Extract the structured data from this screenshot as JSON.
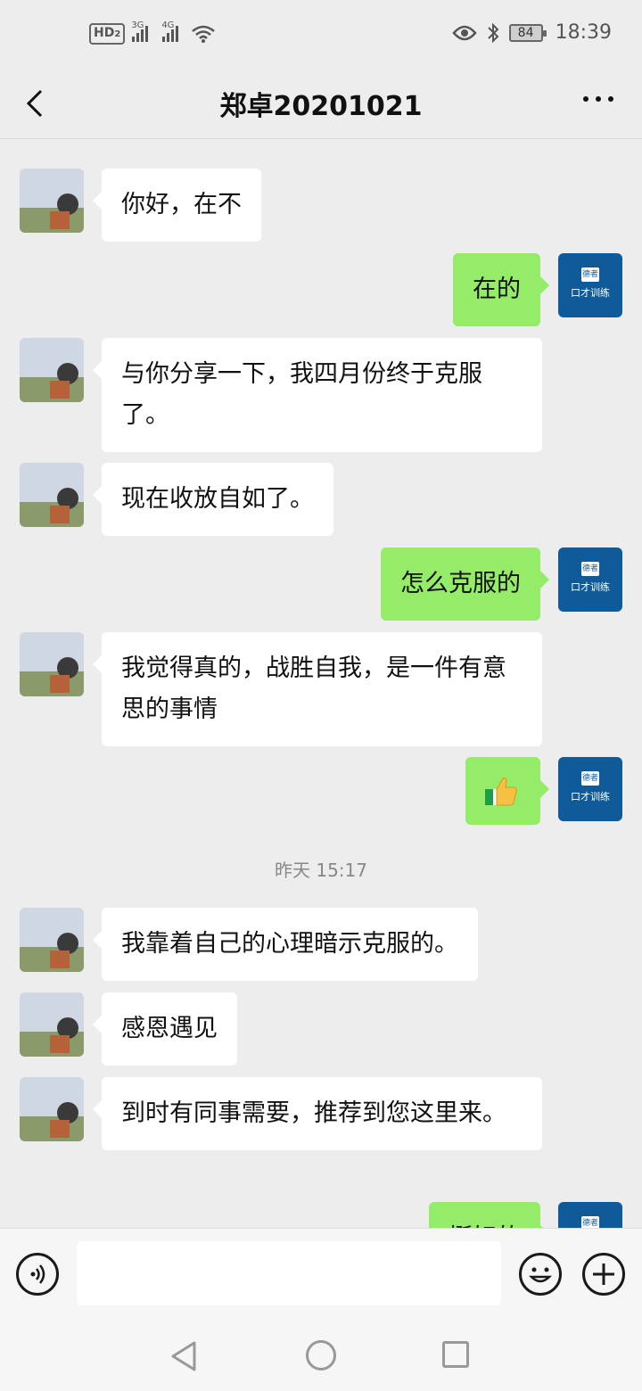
{
  "status_bar": {
    "hd_label": "HD",
    "hd_sub": "2",
    "sim1": "3G",
    "sim2": "4G",
    "battery": "84",
    "time": "18:39"
  },
  "header": {
    "title": "郑卓20201021"
  },
  "avatar_me": {
    "brand_top": "德者",
    "brand_bottom": "口才训练"
  },
  "messages": [
    {
      "side": "other",
      "text": "你好，在不"
    },
    {
      "side": "me",
      "text": "在的"
    },
    {
      "side": "other",
      "text": "与你分享一下，我四月份终于克服了。"
    },
    {
      "side": "other",
      "text": "现在收放自如了。"
    },
    {
      "side": "me",
      "text": "怎么克服的"
    },
    {
      "side": "other",
      "text": "我觉得真的，战胜自我，是一件有意思的事情"
    },
    {
      "side": "me",
      "text": "👍",
      "emoji": "thumbs-up"
    },
    {
      "side": "other",
      "text": "我靠着自己的心理暗示克服的。"
    },
    {
      "side": "other",
      "text": "感恩遇见"
    },
    {
      "side": "other",
      "text": "到时有同事需要，推荐到您这里来。"
    },
    {
      "side": "me",
      "text": "挺好的"
    }
  ],
  "timestamp": "昨天 15:17",
  "colors": {
    "bg": "#ededed",
    "bubble_me": "#95ec69",
    "bubble_other": "#ffffff",
    "avatar_me": "#0f5b9a"
  }
}
